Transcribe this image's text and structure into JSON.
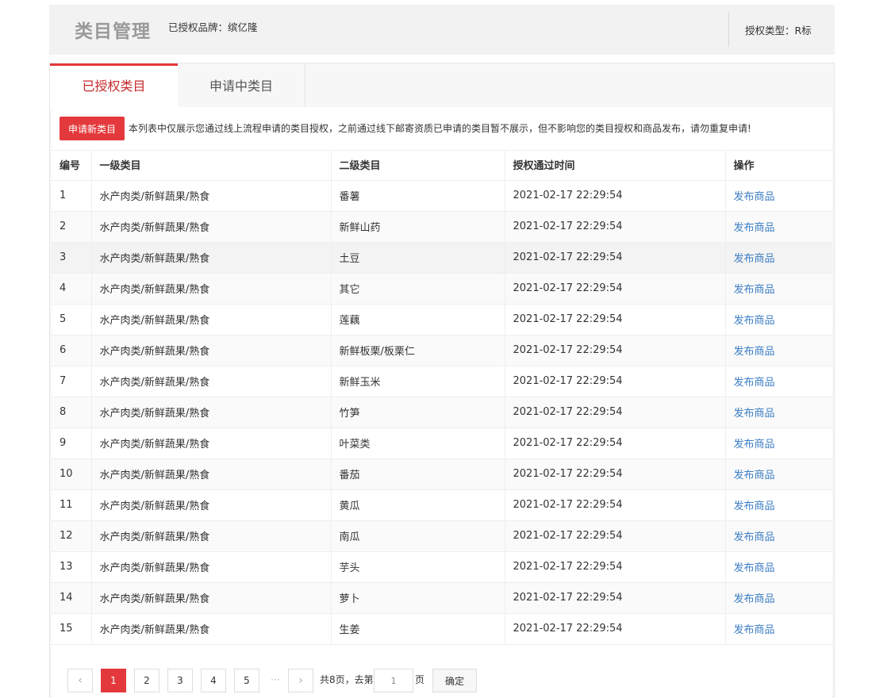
{
  "header": {
    "title": "类目管理",
    "brand_label": "已授权品牌：缤亿隆",
    "auth_type_label": "授权类型：R标"
  },
  "tabs": [
    {
      "label": "已授权类目",
      "active": true
    },
    {
      "label": "申请中类目",
      "active": false
    }
  ],
  "notice": {
    "apply_button": "申请新类目",
    "text": "本列表中仅展示您通过线上流程申请的类目授权，之前通过线下邮寄资质已申请的类目暂不展示，但不影响您的类目授权和商品发布，请勿重复申请!"
  },
  "table": {
    "headers": [
      "编号",
      "一级类目",
      "二级类目",
      "授权通过时间",
      "操作"
    ],
    "rows": [
      {
        "id": "1",
        "level1": "水产肉类/新鲜蔬果/熟食",
        "level2": "番薯",
        "time": "2021-02-17 22:29:54",
        "action": "发布商品"
      },
      {
        "id": "2",
        "level1": "水产肉类/新鲜蔬果/熟食",
        "level2": "新鲜山药",
        "time": "2021-02-17 22:29:54",
        "action": "发布商品"
      },
      {
        "id": "3",
        "level1": "水产肉类/新鲜蔬果/熟食",
        "level2": "土豆",
        "time": "2021-02-17 22:29:54",
        "action": "发布商品"
      },
      {
        "id": "4",
        "level1": "水产肉类/新鲜蔬果/熟食",
        "level2": "其它",
        "time": "2021-02-17 22:29:54",
        "action": "发布商品"
      },
      {
        "id": "5",
        "level1": "水产肉类/新鲜蔬果/熟食",
        "level2": "莲藕",
        "time": "2021-02-17 22:29:54",
        "action": "发布商品"
      },
      {
        "id": "6",
        "level1": "水产肉类/新鲜蔬果/熟食",
        "level2": "新鲜板栗/板栗仁",
        "time": "2021-02-17 22:29:54",
        "action": "发布商品"
      },
      {
        "id": "7",
        "level1": "水产肉类/新鲜蔬果/熟食",
        "level2": "新鲜玉米",
        "time": "2021-02-17 22:29:54",
        "action": "发布商品"
      },
      {
        "id": "8",
        "level1": "水产肉类/新鲜蔬果/熟食",
        "level2": "竹笋",
        "time": "2021-02-17 22:29:54",
        "action": "发布商品"
      },
      {
        "id": "9",
        "level1": "水产肉类/新鲜蔬果/熟食",
        "level2": "叶菜类",
        "time": "2021-02-17 22:29:54",
        "action": "发布商品"
      },
      {
        "id": "10",
        "level1": "水产肉类/新鲜蔬果/熟食",
        "level2": "番茄",
        "time": "2021-02-17 22:29:54",
        "action": "发布商品"
      },
      {
        "id": "11",
        "level1": "水产肉类/新鲜蔬果/熟食",
        "level2": "黄瓜",
        "time": "2021-02-17 22:29:54",
        "action": "发布商品"
      },
      {
        "id": "12",
        "level1": "水产肉类/新鲜蔬果/熟食",
        "level2": "南瓜",
        "time": "2021-02-17 22:29:54",
        "action": "发布商品"
      },
      {
        "id": "13",
        "level1": "水产肉类/新鲜蔬果/熟食",
        "level2": "芋头",
        "time": "2021-02-17 22:29:54",
        "action": "发布商品"
      },
      {
        "id": "14",
        "level1": "水产肉类/新鲜蔬果/熟食",
        "level2": "萝卜",
        "time": "2021-02-17 22:29:54",
        "action": "发布商品"
      },
      {
        "id": "15",
        "level1": "水产肉类/新鲜蔬果/熟食",
        "level2": "生姜",
        "time": "2021-02-17 22:29:54",
        "action": "发布商品"
      }
    ]
  },
  "pagination": {
    "prev_icon": "‹",
    "next_icon": "›",
    "pages": [
      "1",
      "2",
      "3",
      "4",
      "5"
    ],
    "current": "1",
    "ellipsis": "···",
    "total_text": "共8页，去第",
    "input_value": "1",
    "page_suffix": "页",
    "confirm_label": "确定"
  },
  "colors": {
    "accent": "#e4393c",
    "link": "#3b7dc4"
  }
}
